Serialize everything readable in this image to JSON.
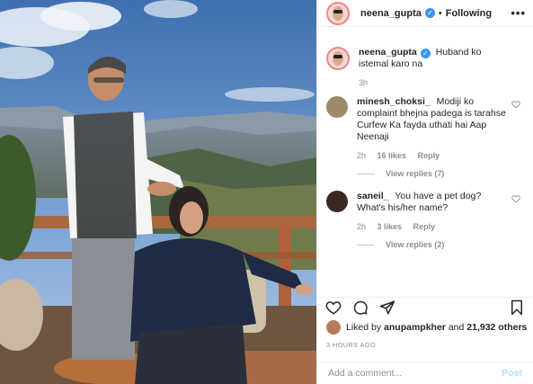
{
  "header": {
    "username": "neena_gupta",
    "verified_mark": "✓",
    "separator": "•",
    "follow_status": "Following",
    "more_label": "•••"
  },
  "caption": {
    "username": "neena_gupta",
    "text": "Huband ko istemal karo na",
    "time": "3h"
  },
  "comments": [
    {
      "username": "minesh_choksi_",
      "text": "Modiji ko complaint bhejna padega is tarahse Curfew Ka fayda uthati hai Aap Neenaji",
      "time": "2h",
      "likes": "16 likes",
      "reply_label": "Reply",
      "view_replies": "View replies (7)"
    },
    {
      "username": "saneil_",
      "text": "You have a pet dog? What's his/her name?",
      "time": "2h",
      "likes": "3 likes",
      "reply_label": "Reply",
      "view_replies": "View replies (2)"
    }
  ],
  "likes": {
    "prefix": "Liked by ",
    "user": "anupampkher",
    "middle": " and ",
    "count": "21,932 others"
  },
  "timestamp": "3 HOURS AGO",
  "add_comment": {
    "placeholder": "Add a comment...",
    "post_label": "Post"
  },
  "icons": {
    "like": "heart-icon",
    "comment": "comment-icon",
    "share": "share-icon",
    "save": "bookmark-icon"
  },
  "colors": {
    "verified": "#3897f0",
    "muted": "#8e8e8e",
    "post_disabled": "#b2dffc"
  }
}
